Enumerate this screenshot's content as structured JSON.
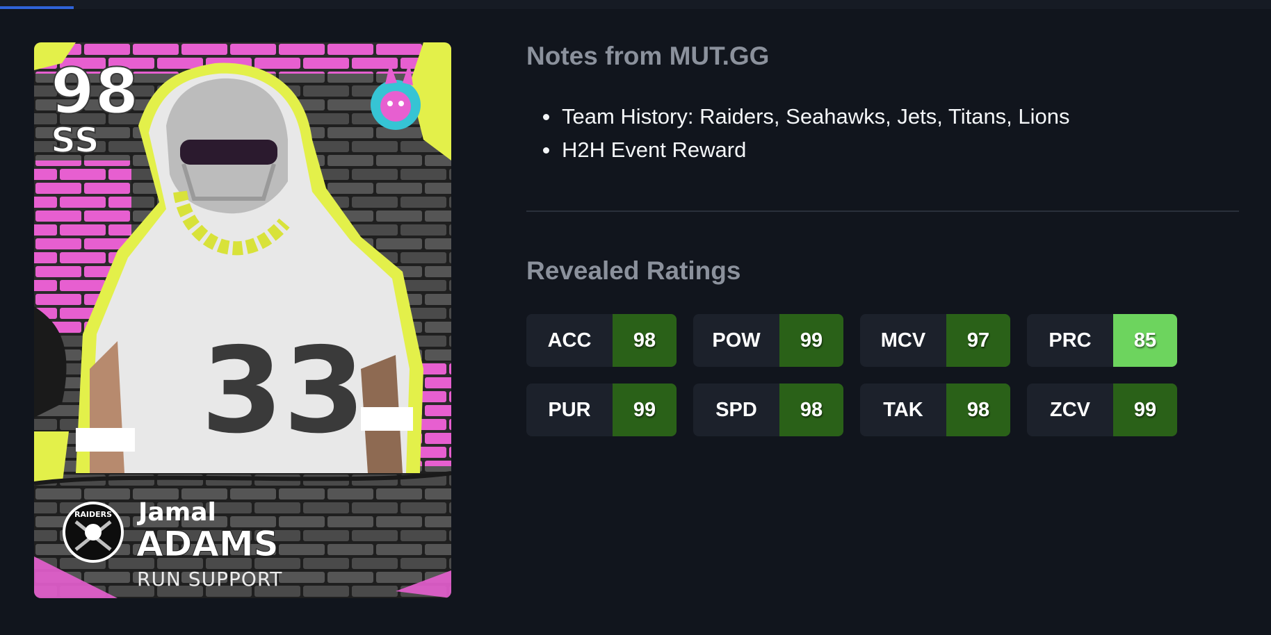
{
  "progress": {
    "value": 0.058
  },
  "card": {
    "overall": "98",
    "position": "SS",
    "first_name": "Jamal",
    "last_name": "ADAMS",
    "archetype": "RUN SUPPORT",
    "team_logo_text": "RAIDERS",
    "jersey_number": "33",
    "colors": {
      "brick_pink": "#e75fd0",
      "accent_yellow": "#e3f04a",
      "brick_gray": "#4a4a4a"
    }
  },
  "notes": {
    "title": "Notes from MUT.GG",
    "items": [
      "Team History: Raiders, Seahawks, Jets, Titans, Lions",
      "H2H Event Reward"
    ]
  },
  "ratings": {
    "title": "Revealed Ratings",
    "items": [
      {
        "label": "ACC",
        "value": "98",
        "color": "#2a6118"
      },
      {
        "label": "POW",
        "value": "99",
        "color": "#2a6118"
      },
      {
        "label": "MCV",
        "value": "97",
        "color": "#2a6118"
      },
      {
        "label": "PRC",
        "value": "85",
        "color": "#6dd45e"
      },
      {
        "label": "PUR",
        "value": "99",
        "color": "#2a6118"
      },
      {
        "label": "SPD",
        "value": "98",
        "color": "#2a6118"
      },
      {
        "label": "TAK",
        "value": "98",
        "color": "#2a6118"
      },
      {
        "label": "ZCV",
        "value": "99",
        "color": "#2a6118"
      }
    ]
  },
  "colors": {
    "background": "#11151d",
    "tile_bg": "#1c212b",
    "section_title": "#8b919c",
    "progress": "#2f63d9"
  }
}
